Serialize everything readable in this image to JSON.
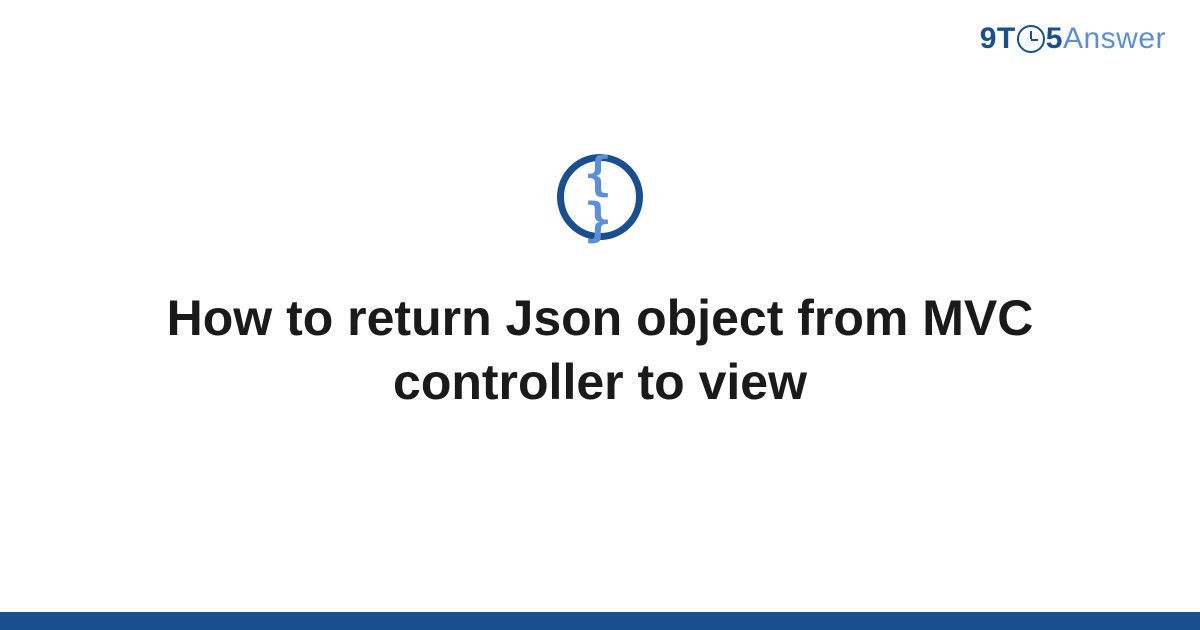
{
  "logo": {
    "part1": "9T",
    "part2": "5",
    "part3": "Answer"
  },
  "icon": {
    "braces": "{ }"
  },
  "title": "How to return Json object from MVC controller to view",
  "colors": {
    "primary": "#1a4f8f",
    "secondary": "#5c8fd6",
    "text": "#1a1a1a"
  }
}
